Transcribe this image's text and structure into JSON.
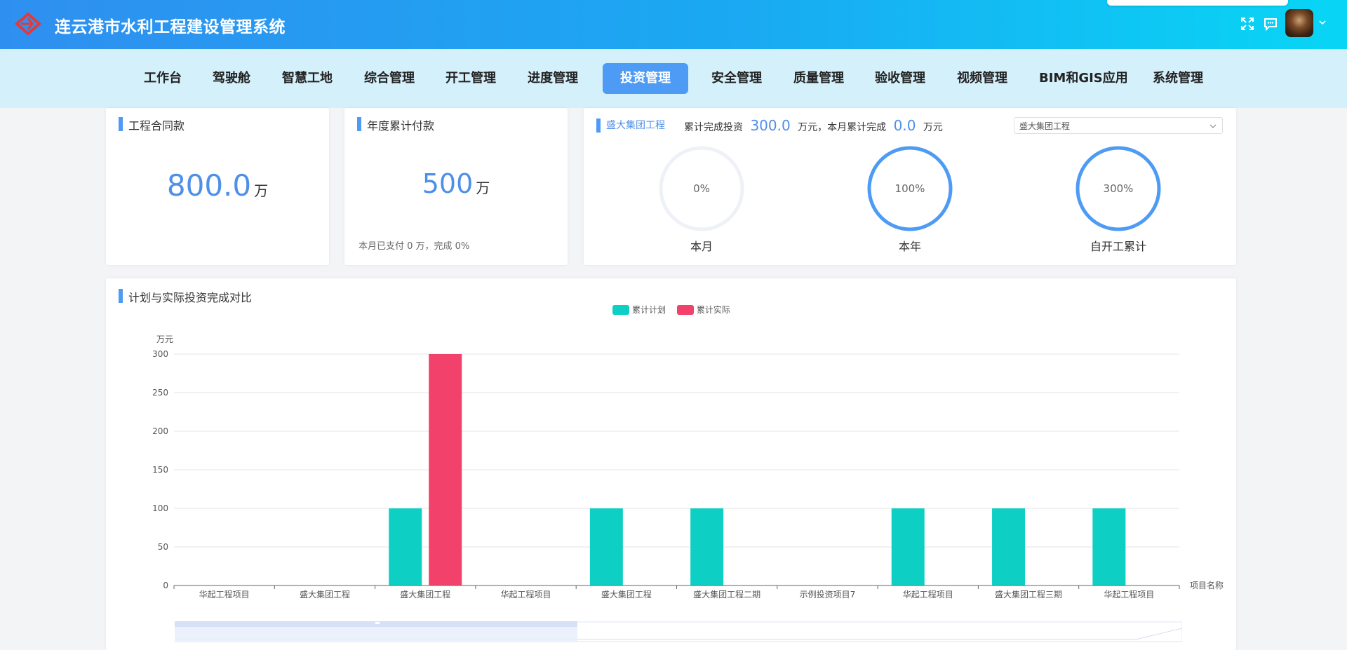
{
  "header": {
    "title": "连云港市水利工程建设管理系统",
    "icons": [
      "logo-icon",
      "fullscreen-icon",
      "message-icon",
      "avatar",
      "chevron-down-icon"
    ]
  },
  "nav": {
    "items": [
      {
        "label": "工作台"
      },
      {
        "label": "驾驶舱"
      },
      {
        "label": "智慧工地"
      },
      {
        "label": "综合管理"
      },
      {
        "label": "开工管理"
      },
      {
        "label": "进度管理"
      },
      {
        "label": "投资管理",
        "active": true
      },
      {
        "label": "安全管理"
      },
      {
        "label": "质量管理"
      },
      {
        "label": "验收管理"
      },
      {
        "label": "视频管理"
      },
      {
        "label": "BIM和GIS应用"
      },
      {
        "label": "系统管理"
      }
    ]
  },
  "contract": {
    "title": "工程合同款",
    "value": "800.0",
    "unit": "万"
  },
  "annual_payment": {
    "title": "年度累计付款",
    "value": "500",
    "unit": "万",
    "note": "本月已支付 0 万，完成 0%"
  },
  "investment": {
    "project_link": "盛大集团工程",
    "cumulative_label": "累计完成投资",
    "cumulative_value": "300.0",
    "month_label": "万元，本月累计完成",
    "month_value": "0.0",
    "month_unit": "万元",
    "select_value": "盛大集团工程",
    "rings": [
      {
        "percent_text": "0%",
        "label": "本月",
        "fill": 0
      },
      {
        "percent_text": "100%",
        "label": "本年",
        "fill": 1
      },
      {
        "percent_text": "300%",
        "label": "自开工累计",
        "fill": 1
      }
    ]
  },
  "colors": {
    "accent": "#4e9bf5",
    "plan": "#0ecfc3",
    "actual": "#f2416a"
  },
  "chart_section": {
    "title": "计划与实际投资完成对比"
  },
  "chart_data": {
    "type": "bar",
    "ylabel": "万元",
    "xlabel": "项目名称",
    "ylim": [
      0,
      300
    ],
    "yticks": [
      0,
      50,
      100,
      150,
      200,
      250,
      300
    ],
    "grid": true,
    "legend_position": "top-center",
    "categories": [
      "华起工程项目",
      "盛大集团工程",
      "盛大集团工程",
      "华起工程项目",
      "盛大集团工程",
      "盛大集团工程二期",
      "示例投资项目7",
      "华起工程项目",
      "盛大集团工程三期",
      "华起工程项目"
    ],
    "series": [
      {
        "name": "累计计划",
        "values": [
          0,
          0,
          100,
          0,
          100,
          100,
          0,
          100,
          100,
          100
        ]
      },
      {
        "name": "累计实际",
        "values": [
          0,
          0,
          300,
          0,
          0,
          0,
          0,
          0,
          0,
          0
        ]
      }
    ]
  }
}
